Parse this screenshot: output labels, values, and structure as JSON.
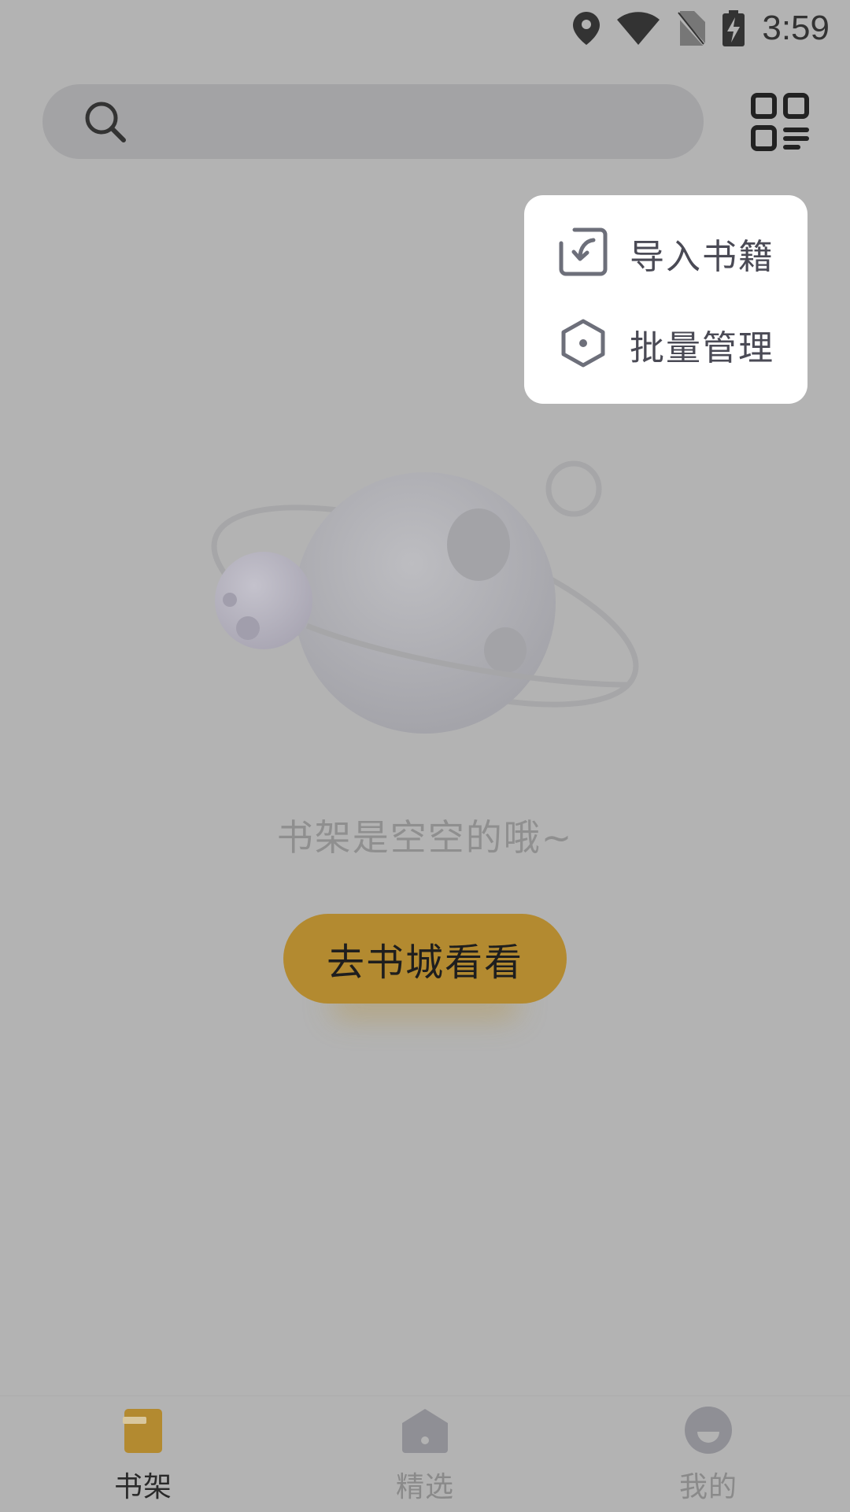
{
  "status_bar": {
    "time": "3:59",
    "icons": [
      "location-icon",
      "wifi-icon",
      "no-sim-icon",
      "battery-charging-icon"
    ]
  },
  "search": {
    "placeholder": ""
  },
  "popup_menu": {
    "items": [
      {
        "label": "导入书籍",
        "icon": "import-icon"
      },
      {
        "label": "批量管理",
        "icon": "hexagon-icon"
      }
    ]
  },
  "empty_state": {
    "message": "书架是空空的哦~",
    "button_label": "去书城看看"
  },
  "bottom_nav": {
    "items": [
      {
        "label": "书架",
        "icon": "bookshelf-icon",
        "active": true
      },
      {
        "label": "精选",
        "icon": "home-icon",
        "active": false
      },
      {
        "label": "我的",
        "icon": "profile-icon",
        "active": false
      }
    ]
  },
  "colors": {
    "overlay_background": "#b3b3b3",
    "accent": "#b38a30",
    "menu_background": "#ffffff"
  }
}
